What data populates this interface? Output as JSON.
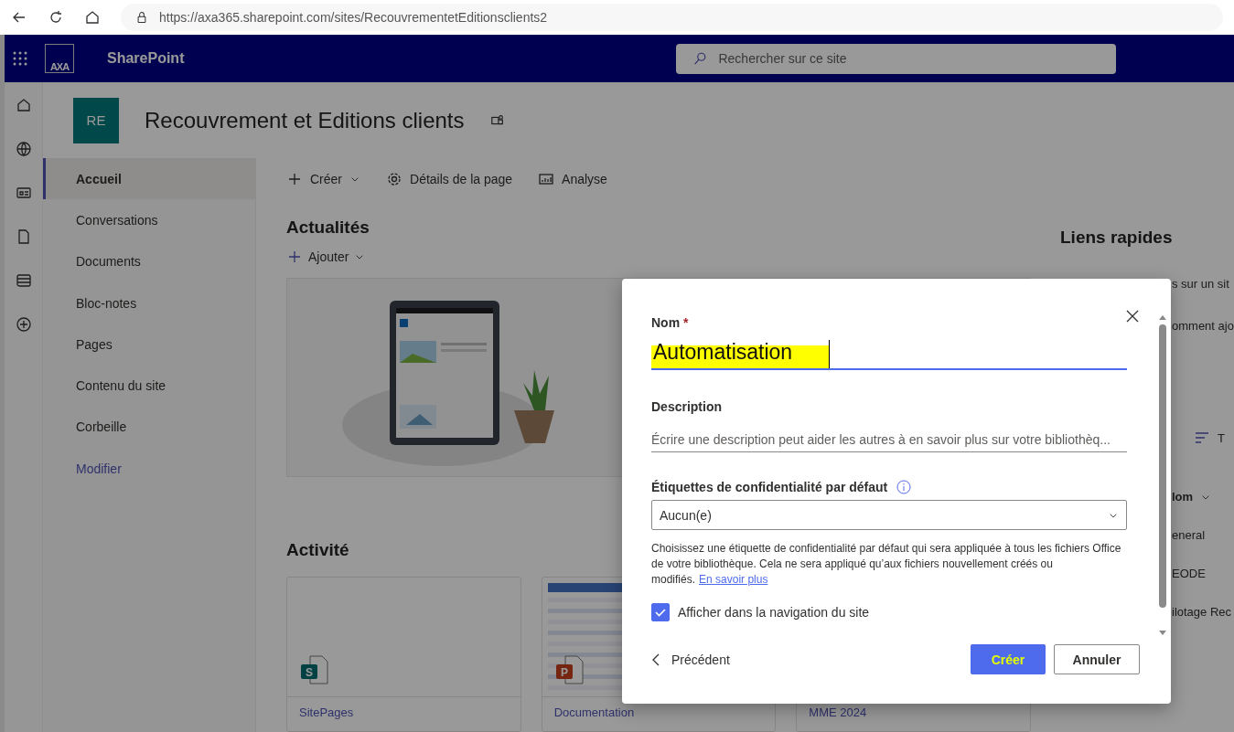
{
  "browser": {
    "url": "https://axa365.sharepoint.com/sites/RecouvrementetEditionsclients2"
  },
  "suite_bar": {
    "logo": "AXA",
    "app_name": "SharePoint",
    "search": {
      "placeholder": "Rechercher sur ce site"
    }
  },
  "site": {
    "initials": "RE",
    "title": "Recouvrement et Editions clients"
  },
  "nav": [
    {
      "label": "Accueil",
      "selected": true,
      "kind": "item"
    },
    {
      "label": "Conversations",
      "selected": false,
      "kind": "item"
    },
    {
      "label": "Documents",
      "selected": false,
      "kind": "item"
    },
    {
      "label": "Bloc-notes",
      "selected": false,
      "kind": "item"
    },
    {
      "label": "Pages",
      "selected": false,
      "kind": "item"
    },
    {
      "label": "Contenu du site",
      "selected": false,
      "kind": "item"
    },
    {
      "label": "Corbeille",
      "selected": false,
      "kind": "item"
    },
    {
      "label": "Modifier",
      "selected": false,
      "kind": "link"
    }
  ],
  "command_bar": [
    {
      "label": "Créer",
      "kind": "create"
    },
    {
      "label": "Détails de la page",
      "kind": "details"
    },
    {
      "label": "Analyse",
      "kind": "analytics"
    }
  ],
  "news": {
    "title": "Actualités",
    "add": "Ajouter"
  },
  "activity": {
    "title": "Activité",
    "cards": [
      {
        "name": "SitePages",
        "kind": "sharepoint",
        "badge": "S"
      },
      {
        "name": "Documentation",
        "kind": "powerpoint",
        "badge": "P"
      },
      {
        "name": "MME 2024",
        "kind": "hidden"
      }
    ]
  },
  "quick_links": {
    "title": "Liens rapides",
    "texts": [
      "s sur un sit",
      "omment ajo"
    ],
    "filter": "T",
    "column": "lom",
    "rows": [
      "eneral",
      "EODE",
      "ilotage Rec"
    ]
  },
  "dialog": {
    "name_label": "Nom",
    "required_mark": "*",
    "name_value": "Automatisation",
    "name_highlighted": true,
    "description_label": "Description",
    "description_placeholder": "Écrire une description peut aider les autres à en savoir plus sur votre bibliothèq...",
    "sensitivity_label": "Étiquettes de confidentialité par défaut",
    "sensitivity_value": "Aucun(e)",
    "help_text": "Choisissez une étiquette de confidentialité par défaut qui sera appliquée à tous les fichiers Office de votre bibliothèque. Cela ne sera appliqué qu’aux fichiers nouvellement créés ou modifiés.",
    "help_link": "En savoir plus",
    "show_in_nav": {
      "label": "Afficher dans la navigation du site",
      "checked": true
    },
    "back": "Précédent",
    "primary": {
      "label": "Créer",
      "highlighted": true
    },
    "cancel": "Annuler"
  }
}
